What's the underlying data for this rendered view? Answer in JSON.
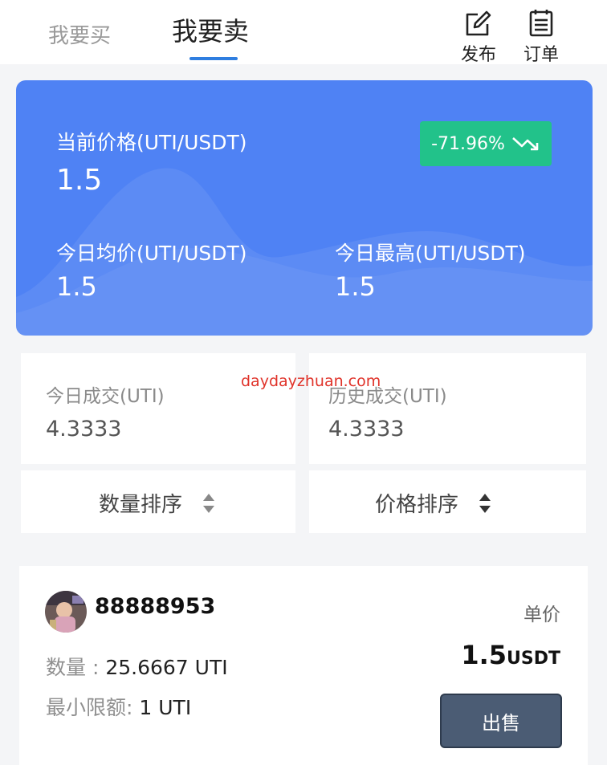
{
  "tabs": {
    "buy": "我要买",
    "sell": "我要卖"
  },
  "actions": {
    "publish": "发布",
    "orders": "订单"
  },
  "price_card": {
    "current_label": "当前价格(UTI/USDT)",
    "current_value": "1.5",
    "change": "-71.96%",
    "avg_label": "今日均价(UTI/USDT)",
    "avg_value": "1.5",
    "high_label": "今日最高(UTI/USDT)",
    "high_value": "1.5"
  },
  "stats": {
    "today_label": "今日成交(UTI)",
    "today_value": "4.3333",
    "history_label": "历史成交(UTI)",
    "history_value": "4.3333"
  },
  "watermark": "daydayzhuan.com",
  "sort": {
    "by_quantity": "数量排序",
    "by_price": "价格排序"
  },
  "order": {
    "username": "88888953",
    "unit_label": "单价",
    "unit_price": "1.5",
    "unit_currency": "USDT",
    "qty_label": "数量 :",
    "qty_value": "25.6667 UTI",
    "min_label": "最小限额:",
    "min_value": "1 UTI",
    "sell_label": "出售"
  },
  "colors": {
    "card_blue": "#4f82f4",
    "badge_green": "#22c28a",
    "tab_underline": "#2f7ee0",
    "sell_button": "#4b5c74"
  },
  "icons": [
    "edit-icon",
    "clipboard-icon",
    "trend-down-icon",
    "sort-icon"
  ]
}
